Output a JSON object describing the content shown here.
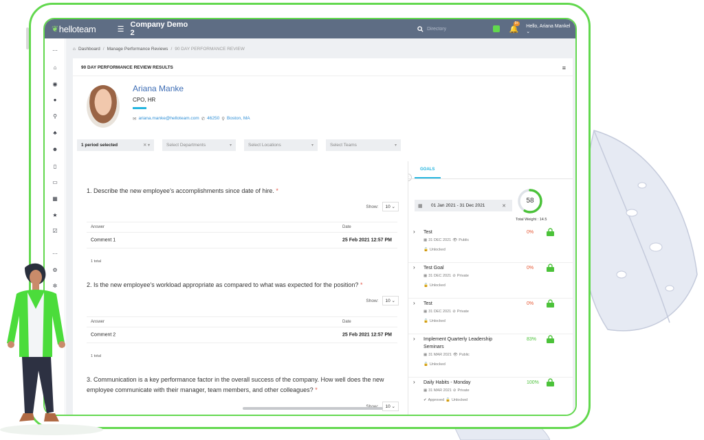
{
  "colors": {
    "frame_green": "#62d84e",
    "topbar": "#5e6d84",
    "link_blue": "#3c6cb4",
    "accent_cyan": "#24b5df",
    "percent_red": "#e5532e",
    "percent_green": "#4bc239"
  },
  "topbar": {
    "logo": "helloteam",
    "company": "Company Demo 2",
    "search_placeholder": "Directory",
    "notification_count": "9+",
    "user": "Hello, Ariana Mankel"
  },
  "breadcrumb": {
    "home": "Dashboard",
    "sep1": "/",
    "parent": "Manage Performance Reviews",
    "sep2": "/",
    "current": "90 DAY PERFORMANCE REVIEW"
  },
  "card": {
    "title": "90 DAY PERFORMANCE REVIEW RESULTS"
  },
  "profile": {
    "name": "Ariana Manke",
    "role": "CPO, HR",
    "email": "ariana.manke@helloteam.com",
    "phone": "46250",
    "location": "Boston, MA"
  },
  "filters": {
    "period": "1 period selected",
    "departments": "Select Departments",
    "locations": "Select Locations",
    "teams": "Select Teams"
  },
  "questions": [
    {
      "text": "1. Describe the new employee's accomplishments since date of hire.",
      "required": "*",
      "show_label": "Show:",
      "show_value": "10",
      "col_answer": "Answer",
      "col_date": "Date",
      "answer": "Comment 1",
      "date": "25 Feb 2021 12:57 PM",
      "total": "1 total"
    },
    {
      "text": "2. Is the new employee's workload appropriate as compared to what was expected for the position?",
      "required": "*",
      "show_label": "Show:",
      "show_value": "10",
      "col_answer": "Answer",
      "col_date": "Date",
      "answer": "Comment 2",
      "date": "25 Feb 2021 12:57 PM",
      "total": "1 total"
    },
    {
      "text": "3. Communication is a key performance factor in the overall success of the company. How well does the new employee communicate with their manager, team members, and other colleagues?",
      "required": "*",
      "show_label": "Show:",
      "show_value": "10"
    }
  ],
  "goals": {
    "tab": "GOALS",
    "date_range": "01 Jan 2021 - 31 Dec 2021",
    "score": "58",
    "score_fraction": 0.58,
    "total_weight": "Total Weight : 14.5",
    "items": [
      {
        "title": "Test",
        "date": "31 DEC 2021",
        "visibility": "Public",
        "status": "Unlocked",
        "percent": "0%"
      },
      {
        "title": "Test Goal",
        "date": "31 DEC 2021",
        "visibility": "Private",
        "status": "Unlocked",
        "percent": "0%"
      },
      {
        "title": "Test",
        "date": "31 DEC 2021",
        "visibility": "Private",
        "status": "Unlocked",
        "percent": "0%"
      },
      {
        "title": "Implement Quarterly Leadership Seminars",
        "date": "31 MAR 2021",
        "visibility": "Public",
        "status": "Unlocked",
        "percent": "83%"
      },
      {
        "title": "Daily Habits - Monday",
        "date": "31 MAR 2021",
        "visibility": "Private",
        "approved": "Approved",
        "status": "Unlocked",
        "percent": "100%"
      }
    ]
  }
}
